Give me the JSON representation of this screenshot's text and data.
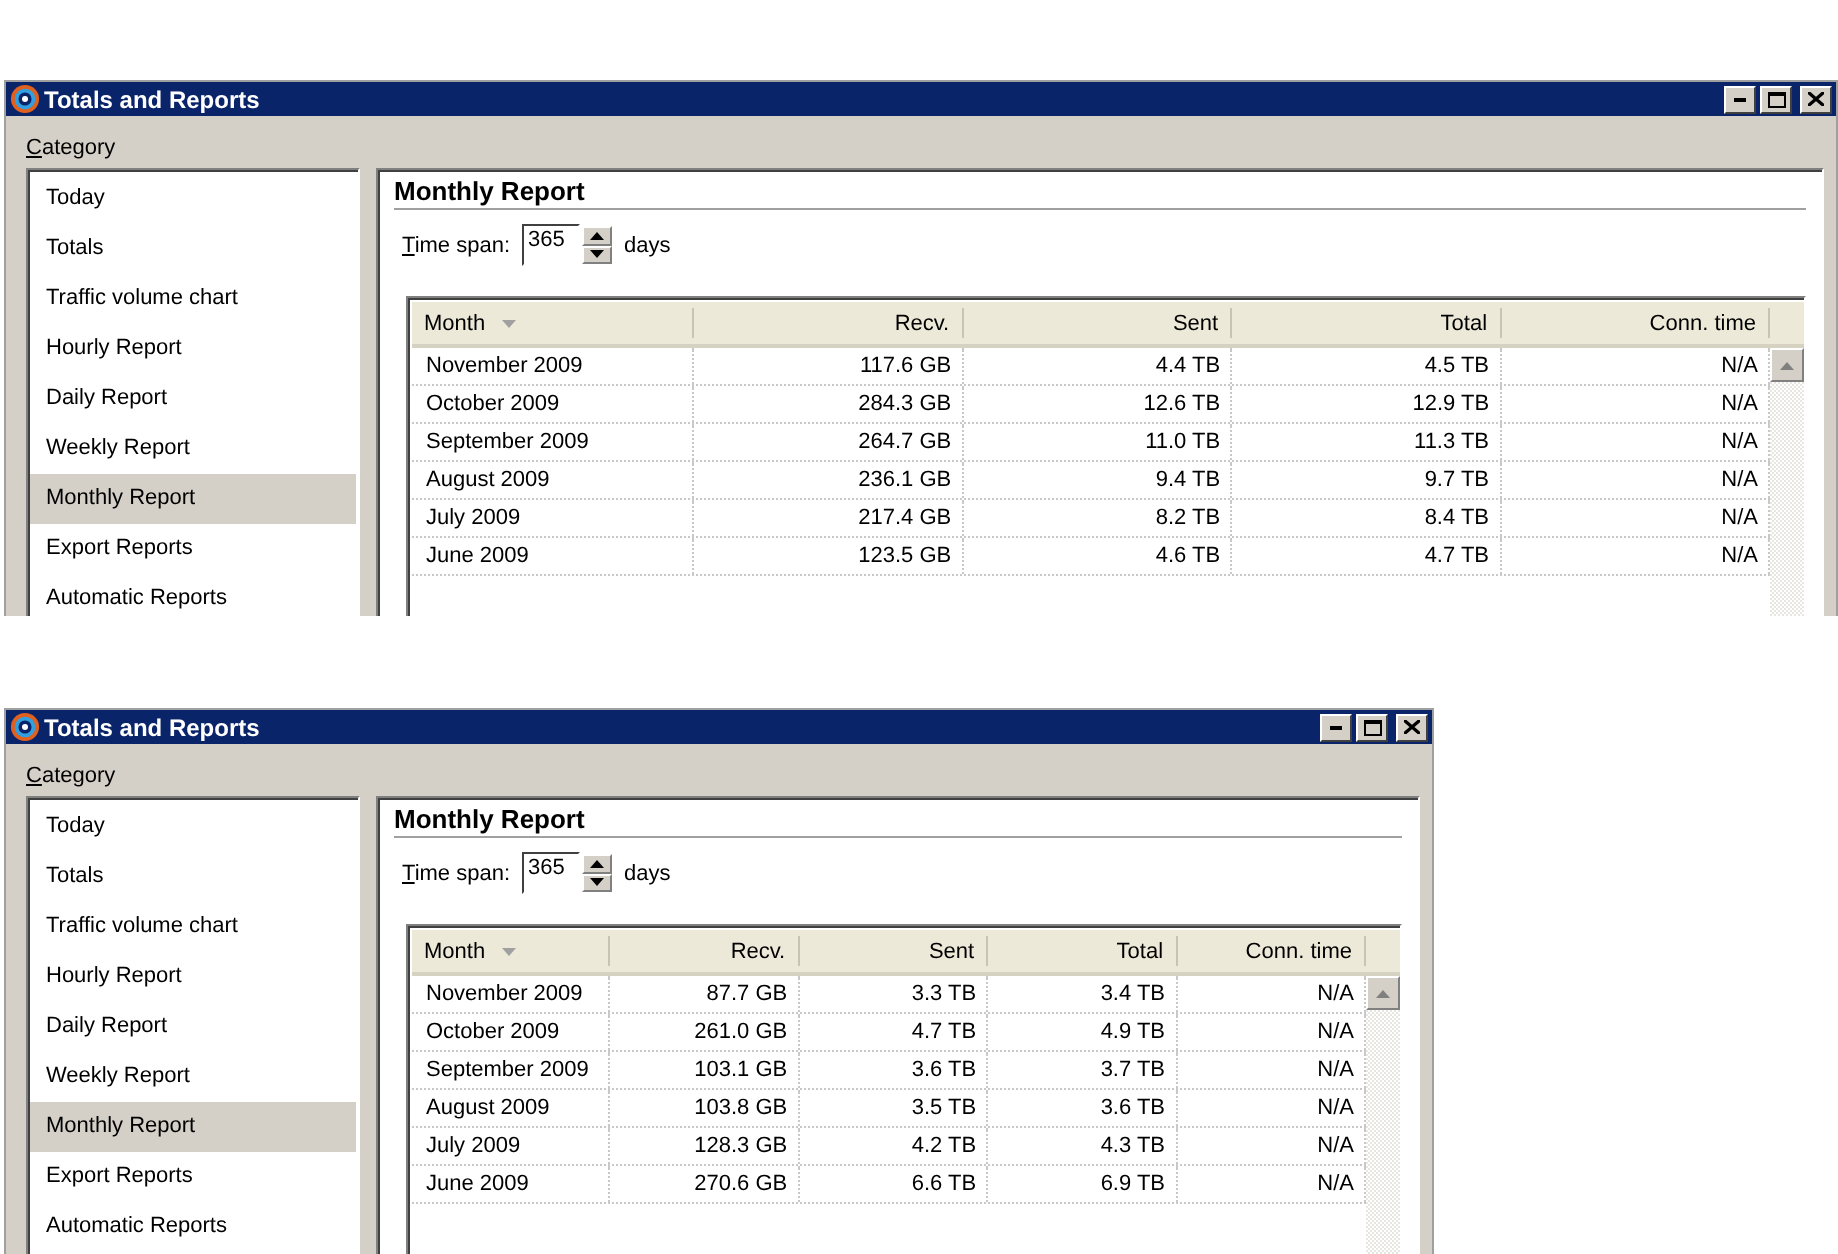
{
  "windows": [
    {
      "title": "Totals and Reports",
      "category_label": "Category",
      "categories": [
        {
          "label": "Today",
          "selected": false
        },
        {
          "label": "Totals",
          "selected": false
        },
        {
          "label": "Traffic volume chart",
          "selected": false
        },
        {
          "label": "Hourly Report",
          "selected": false
        },
        {
          "label": "Daily Report",
          "selected": false
        },
        {
          "label": "Weekly Report",
          "selected": false
        },
        {
          "label": "Monthly Report",
          "selected": true
        },
        {
          "label": "Export Reports",
          "selected": false
        },
        {
          "label": "Automatic Reports",
          "selected": false
        }
      ],
      "report_title": "Monthly Report",
      "time_span": {
        "label": "Time span:",
        "value": "365",
        "unit": "days"
      },
      "table": {
        "columns": [
          {
            "label": "Month",
            "sorted": true
          },
          {
            "label": "Recv.",
            "sorted": false
          },
          {
            "label": "Sent",
            "sorted": false
          },
          {
            "label": "Total",
            "sorted": false
          },
          {
            "label": "Conn. time",
            "sorted": false
          }
        ],
        "rows": [
          [
            "November 2009",
            "117.6 GB",
            "4.4 TB",
            "4.5 TB",
            "N/A"
          ],
          [
            "October 2009",
            "284.3 GB",
            "12.6 TB",
            "12.9 TB",
            "N/A"
          ],
          [
            "September 2009",
            "264.7 GB",
            "11.0 TB",
            "11.3 TB",
            "N/A"
          ],
          [
            "August 2009",
            "236.1 GB",
            "9.4 TB",
            "9.7 TB",
            "N/A"
          ],
          [
            "July 2009",
            "217.4 GB",
            "8.2 TB",
            "8.4 TB",
            "N/A"
          ],
          [
            "June 2009",
            "123.5 GB",
            "4.6 TB",
            "4.7 TB",
            "N/A"
          ]
        ]
      }
    },
    {
      "title": "Totals and Reports",
      "category_label": "Category",
      "categories": [
        {
          "label": "Today",
          "selected": false
        },
        {
          "label": "Totals",
          "selected": false
        },
        {
          "label": "Traffic volume chart",
          "selected": false
        },
        {
          "label": "Hourly Report",
          "selected": false
        },
        {
          "label": "Daily Report",
          "selected": false
        },
        {
          "label": "Weekly Report",
          "selected": false
        },
        {
          "label": "Monthly Report",
          "selected": true
        },
        {
          "label": "Export Reports",
          "selected": false
        },
        {
          "label": "Automatic Reports",
          "selected": false
        }
      ],
      "report_title": "Monthly Report",
      "time_span": {
        "label": "Time span:",
        "value": "365",
        "unit": "days"
      },
      "table": {
        "columns": [
          {
            "label": "Month",
            "sorted": true
          },
          {
            "label": "Recv.",
            "sorted": false
          },
          {
            "label": "Sent",
            "sorted": false
          },
          {
            "label": "Total",
            "sorted": false
          },
          {
            "label": "Conn. time",
            "sorted": false
          }
        ],
        "rows": [
          [
            "November 2009",
            "87.7 GB",
            "3.3 TB",
            "3.4 TB",
            "N/A"
          ],
          [
            "October 2009",
            "261.0 GB",
            "4.7 TB",
            "4.9 TB",
            "N/A"
          ],
          [
            "September 2009",
            "103.1 GB",
            "3.6 TB",
            "3.7 TB",
            "N/A"
          ],
          [
            "August 2009",
            "103.8 GB",
            "3.5 TB",
            "3.6 TB",
            "N/A"
          ],
          [
            "July 2009",
            "128.3 GB",
            "4.2 TB",
            "4.3 TB",
            "N/A"
          ],
          [
            "June 2009",
            "270.6 GB",
            "6.6 TB",
            "6.9 TB",
            "N/A"
          ]
        ]
      }
    }
  ]
}
